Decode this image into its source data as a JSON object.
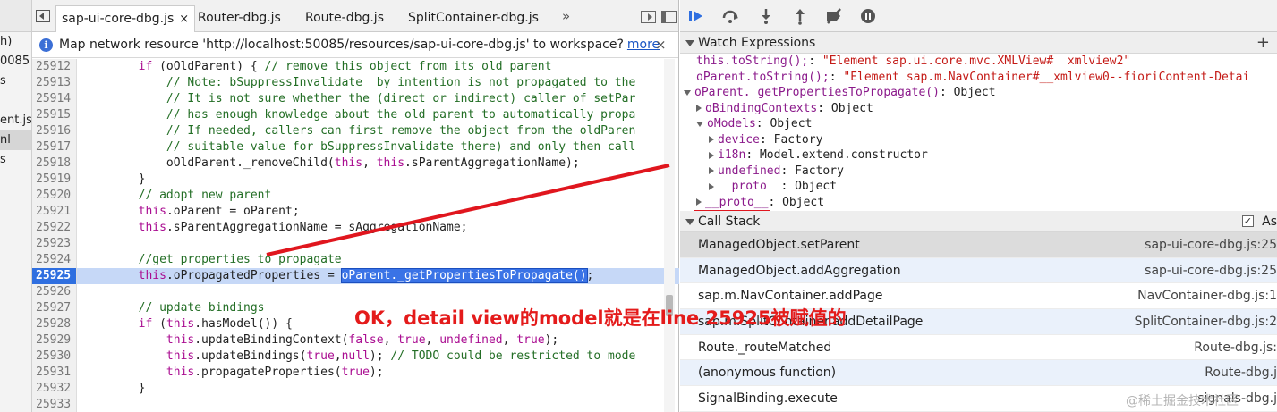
{
  "navigator": {
    "items": [
      "h)",
      "0085",
      "s",
      "",
      "ent.js",
      "nl",
      "s"
    ]
  },
  "tabs": [
    {
      "label": "sap-ui-core-dbg.js",
      "active": true,
      "close": "×"
    },
    {
      "label": "Router-dbg.js"
    },
    {
      "label": "Route-dbg.js"
    },
    {
      "label": "SplitContainer-dbg.js"
    }
  ],
  "tab_overflow": "»",
  "infobar": {
    "icon": "i",
    "message": "Map network resource 'http://localhost:50085/resources/sap-ui-core-dbg.js' to workspace?",
    "link": "more",
    "close": "×"
  },
  "code": [
    {
      "ln": "25912",
      "src": "        if (oOldParent) { // remove this object from its old parent"
    },
    {
      "ln": "25913",
      "src": "            // Note: bSuppressInvalidate  by intention is not propagated to the"
    },
    {
      "ln": "25914",
      "src": "            // It is not sure whether the (direct or indirect) caller of setPar"
    },
    {
      "ln": "25915",
      "src": "            // has enough knowledge about the old parent to automatically propa"
    },
    {
      "ln": "25916",
      "src": "            // If needed, callers can first remove the object from the oldParen"
    },
    {
      "ln": "25917",
      "src": "            // suitable value for bSuppressInvalidate there) and only then call"
    },
    {
      "ln": "25918",
      "src": "            oOldParent._removeChild(this, this.sParentAggregationName);"
    },
    {
      "ln": "25919",
      "src": "        }"
    },
    {
      "ln": "25920",
      "src": "        // adopt new parent"
    },
    {
      "ln": "25921",
      "src": "        this.oParent = oParent;"
    },
    {
      "ln": "25922",
      "src": "        this.sParentAggregationName = sAggregationName;"
    },
    {
      "ln": "25923",
      "src": ""
    },
    {
      "ln": "25924",
      "src": "        //get properties to propagate"
    },
    {
      "ln": "25925",
      "src": "        this.oPropagatedProperties = oParent._getPropertiesToPropagate();"
    },
    {
      "ln": "25926",
      "src": ""
    },
    {
      "ln": "25927",
      "src": "        // update bindings"
    },
    {
      "ln": "25928",
      "src": "        if (this.hasModel()) {"
    },
    {
      "ln": "25929",
      "src": "            this.updateBindingContext(false, true, undefined, true);"
    },
    {
      "ln": "25930",
      "src": "            this.updateBindings(true,null); // TODO could be restricted to mode"
    },
    {
      "ln": "25931",
      "src": "            this.propagateProperties(true);"
    },
    {
      "ln": "25932",
      "src": "        }"
    },
    {
      "ln": "25933",
      "src": ""
    }
  ],
  "breakpoint_line": "25925",
  "watch": {
    "title": "Watch Expressions",
    "add": "+",
    "rows": [
      {
        "indent": 0,
        "tri": "",
        "key": "this.toString();",
        "sep": ": ",
        "val": "\"Element sap.ui.core.mvc.XMLView#  xmlview2\"",
        "str": true
      },
      {
        "indent": 0,
        "tri": "",
        "key": "oParent.toString();",
        "sep": ": ",
        "val": "\"Element sap.m.NavContainer#__xmlview0--fioriContent-Detai",
        "str": true
      },
      {
        "indent": 0,
        "tri": "down",
        "key": "oParent. getPropertiesToPropagate()",
        "sep": ": ",
        "val": "Object",
        "str": false
      },
      {
        "indent": 1,
        "tri": "right",
        "key": "oBindingContexts",
        "sep": ": ",
        "val": "Object",
        "str": false
      },
      {
        "indent": 1,
        "tri": "down",
        "key": "oModels",
        "sep": ": ",
        "val": "Object",
        "str": false
      },
      {
        "indent": 2,
        "tri": "right",
        "key": "device",
        "sep": ": ",
        "val": "Factory",
        "str": false
      },
      {
        "indent": 2,
        "tri": "right",
        "key": "i18n",
        "sep": ": ",
        "val": "Model.extend.constructor",
        "str": false
      },
      {
        "indent": 2,
        "tri": "right",
        "key": "undefined",
        "sep": ": ",
        "val": "Factory",
        "str": false
      },
      {
        "indent": 2,
        "tri": "right",
        "key": "  proto  ",
        "sep": ": ",
        "val": "Object",
        "str": false
      },
      {
        "indent": 1,
        "tri": "right",
        "key": "__proto__",
        "sep": ": ",
        "val": "Object",
        "str": false
      }
    ]
  },
  "callstack": {
    "title": "Call Stack",
    "async_label": "As",
    "checked": "✓",
    "frames": [
      {
        "fn": "ManagedObject.setParent",
        "loc": "sap-ui-core-dbg.js:25"
      },
      {
        "fn": "ManagedObject.addAggregation",
        "loc": "sap-ui-core-dbg.js:25"
      },
      {
        "fn": "sap.m.NavContainer.addPage",
        "loc": "NavContainer-dbg.js:1"
      },
      {
        "fn": "sap.m.SplitContainer.addDetailPage",
        "loc": "SplitContainer-dbg.js:2"
      },
      {
        "fn": "Route._routeMatched",
        "loc": "Route-dbg.js:"
      },
      {
        "fn": "(anonymous function)",
        "loc": "Route-dbg.j"
      },
      {
        "fn": "SignalBinding.execute",
        "loc": "signals-dbg.j"
      }
    ]
  },
  "annotation": {
    "text": "OK，detail view的model就是在line 25925被赋值的",
    "color": "#e41b1b"
  },
  "watermark": "@稀土掘金技术社区",
  "colors": {
    "breakpoint": "#2f6fe0",
    "comment": "#236e25",
    "keyword": "#aa0d91",
    "string": "#c41a16",
    "link": "#1a55c4"
  }
}
